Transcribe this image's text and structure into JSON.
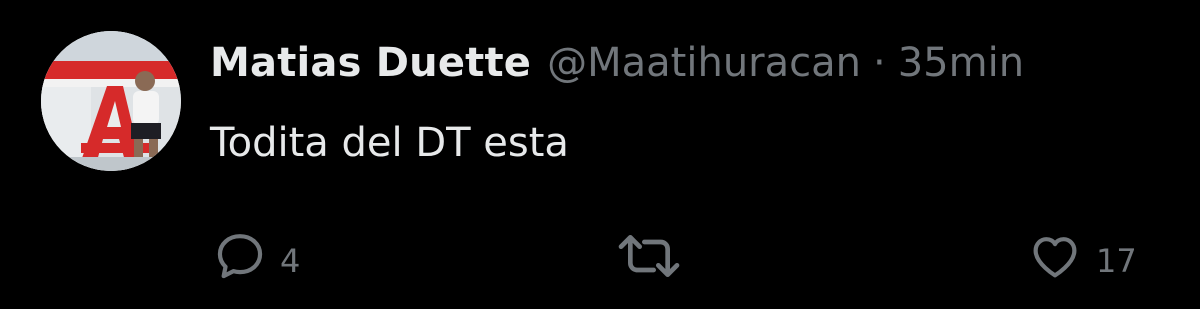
{
  "tweet": {
    "author": {
      "display_name": "Matias Duette",
      "handle": "@Maatihuracan"
    },
    "separator": "·",
    "time": "35min",
    "text": "Todita del DT esta",
    "actions": {
      "reply": {
        "icon": "reply-icon",
        "count": "4"
      },
      "retweet": {
        "icon": "retweet-icon",
        "count": ""
      },
      "like": {
        "icon": "heart-icon",
        "count": "17"
      }
    }
  },
  "colors": {
    "background": "#000000",
    "primary_text": "#e7e9ea",
    "secondary_text": "#71767b",
    "avatar_accent": "#d62a2a"
  }
}
